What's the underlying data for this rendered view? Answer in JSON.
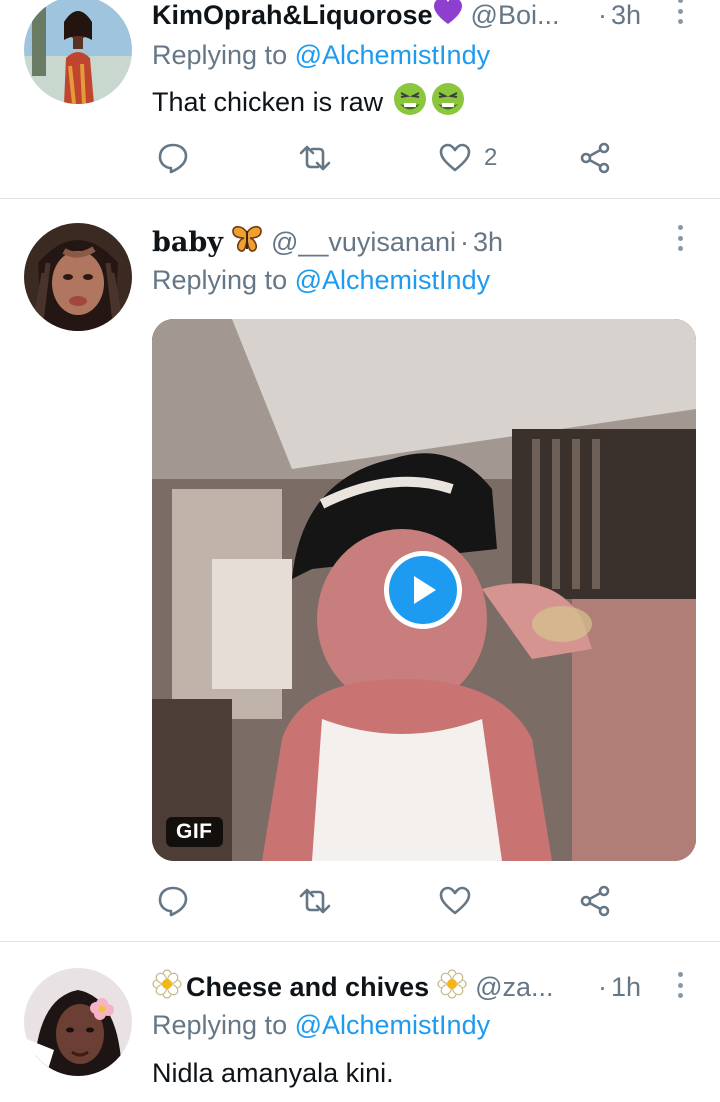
{
  "tweets": [
    {
      "display_name": "KimOprah&Liquorose",
      "name_emoji": "purple-heart-emoji",
      "handle": "@Boi...",
      "time": "3h",
      "reply_prefix": "Replying to",
      "reply_to": "@AlchemistIndy",
      "text": "That chicken is raw",
      "text_emojis": [
        "nauseated-face-emoji",
        "nauseated-face-emoji"
      ],
      "like_count": "2"
    },
    {
      "display_name": "baby",
      "name_emoji": "butterfly-emoji",
      "handle": "@__vuyisanani",
      "time": "3h",
      "reply_prefix": "Replying to",
      "reply_to": "@AlchemistIndy",
      "media_badge": "GIF"
    },
    {
      "display_name": "Cheese and chives",
      "name_emoji": "blossom-emoji",
      "handle": "@za...",
      "time": "1h",
      "reply_prefix": "Replying to",
      "reply_to": "@AlchemistIndy",
      "text": "Nidla amanyala kini."
    }
  ],
  "colors": {
    "accent": "#1d9bf0",
    "secondary_text": "#657786",
    "primary_text": "#0f1419",
    "divider": "#dde3e8"
  }
}
